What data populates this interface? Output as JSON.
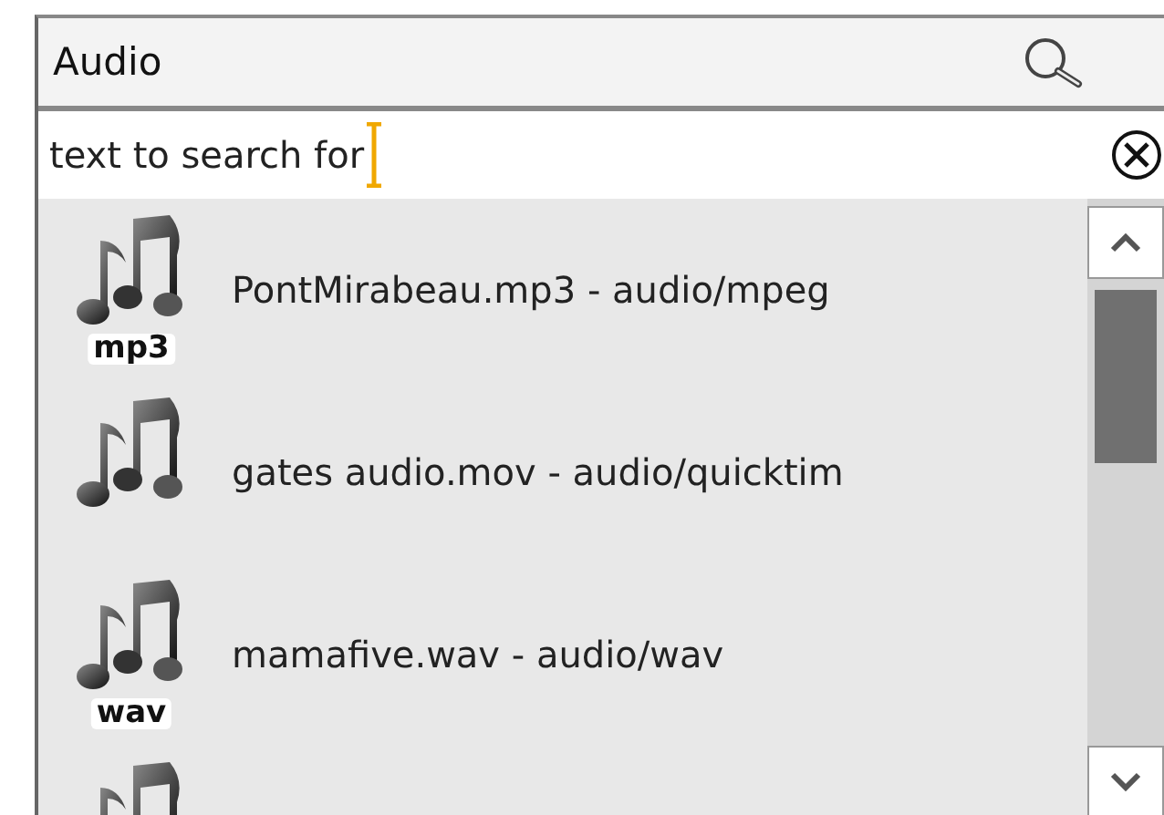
{
  "header": {
    "title": "Audio"
  },
  "search": {
    "value": "text to search for"
  },
  "items": [
    {
      "kind": "file",
      "name": "PontMirabeau.mp3 - audio/mpeg",
      "badge": "mp3"
    },
    {
      "kind": "file",
      "name": "gates audio.mov - audio/quicktim"
    },
    {
      "kind": "file",
      "name": "mamafive.wav - audio/wav",
      "badge": "wav"
    },
    {
      "kind": "cut-off"
    }
  ]
}
